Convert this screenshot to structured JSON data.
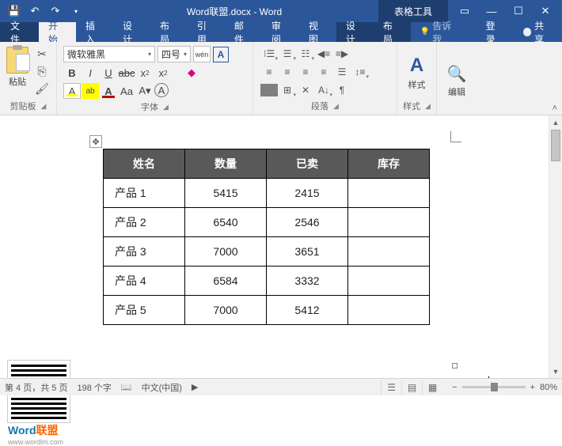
{
  "titlebar": {
    "title": "Word联盟.docx - Word",
    "contextual": "表格工具"
  },
  "tabs": {
    "file": "文件",
    "home": "开始",
    "insert": "插入",
    "design": "设计",
    "layout": "布局",
    "references": "引用",
    "mailings": "邮件",
    "review": "审阅",
    "view": "视图",
    "table_design": "设计",
    "table_layout": "布局",
    "tell_me": "告诉我...",
    "signin": "登录",
    "share": "共享"
  },
  "ribbon": {
    "clipboard": {
      "label": "剪贴板",
      "paste": "粘贴"
    },
    "font": {
      "label": "字体",
      "name": "微软雅黑",
      "size": "四号",
      "wen": "wén",
      "grow": "A",
      "shrink": "A"
    },
    "paragraph": {
      "label": "段落"
    },
    "styles": {
      "label": "样式",
      "btn": "样式"
    },
    "editing": {
      "label": "",
      "btn": "编辑"
    }
  },
  "table": {
    "headers": [
      "姓名",
      "数量",
      "已卖",
      "库存"
    ],
    "rows": [
      {
        "c0": "产品 1",
        "c1": "5415",
        "c2": "2415",
        "c3": ""
      },
      {
        "c0": "产品 2",
        "c1": "6540",
        "c2": "2546",
        "c3": ""
      },
      {
        "c0": "产品 3",
        "c1": "7000",
        "c2": "3651",
        "c3": ""
      },
      {
        "c0": "产品 4",
        "c1": "6584",
        "c2": "3332",
        "c3": ""
      },
      {
        "c0": "产品 5",
        "c1": "7000",
        "c2": "5412",
        "c3": ""
      }
    ]
  },
  "watermark": {
    "brand1": "Word",
    "brand2": "联盟",
    "url": "www.wordlm.com"
  },
  "status": {
    "page": "第 4 页，共 5 页",
    "words": "198 个字",
    "lang": "中文(中国)",
    "zoom": "80%"
  }
}
